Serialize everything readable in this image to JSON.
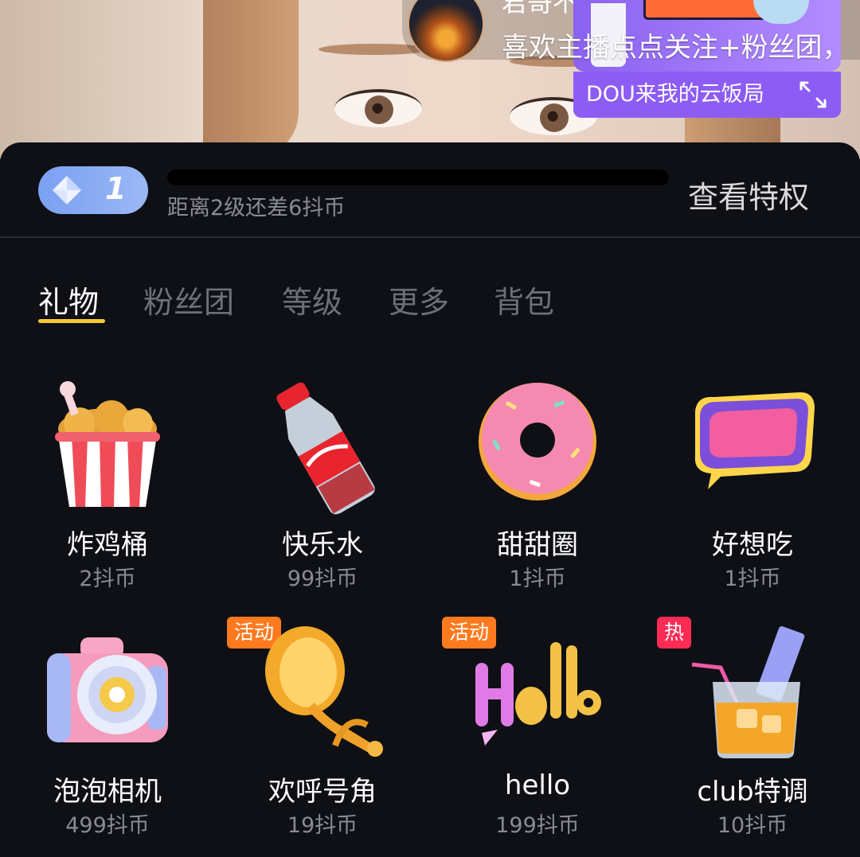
{
  "stream": {
    "anchor_name": "君哥不酷",
    "follow_message": "喜欢主播点点关注+粉丝团，",
    "event_label": "DOU来我的云饭局",
    "expand_icon": "expand-icon"
  },
  "level": {
    "current_level": "1",
    "gem_icon": "diamond-icon",
    "progress_fraction": 0.0,
    "hint": "距离2级还差6抖币",
    "privilege_link": "查看特权"
  },
  "tabs": [
    {
      "label": "礼物",
      "active": true
    },
    {
      "label": "粉丝团",
      "active": false
    },
    {
      "label": "等级",
      "active": false
    },
    {
      "label": "更多",
      "active": false
    },
    {
      "label": "背包",
      "active": false
    }
  ],
  "gifts": [
    {
      "name": "炸鸡桶",
      "price": "2抖币",
      "badge": "",
      "icon": "fried-chicken-bucket-icon"
    },
    {
      "name": "快乐水",
      "price": "99抖币",
      "badge": "",
      "icon": "soda-bottle-icon"
    },
    {
      "name": "甜甜圈",
      "price": "1抖币",
      "badge": "",
      "icon": "donut-icon"
    },
    {
      "name": "好想吃",
      "price": "1抖币",
      "badge": "",
      "icon": "want-to-eat-sticker-icon"
    },
    {
      "name": "泡泡相机",
      "price": "499抖币",
      "badge": "",
      "icon": "bubble-camera-icon"
    },
    {
      "name": "欢呼号角",
      "price": "19抖币",
      "badge": "活动",
      "icon": "trumpet-icon"
    },
    {
      "name": "hello",
      "price": "199抖币",
      "badge": "活动",
      "icon": "hello-balloon-icon"
    },
    {
      "name": "club特调",
      "price": "10抖币",
      "badge": "热",
      "icon": "cocktail-icon"
    }
  ],
  "colors": {
    "panel_bg": "#0e1016",
    "tab_active_underline": "#f6c933",
    "badge_activity": "#ff7a1f",
    "badge_hot": "#fe2c55",
    "event_purple": "#8d5cf5"
  }
}
